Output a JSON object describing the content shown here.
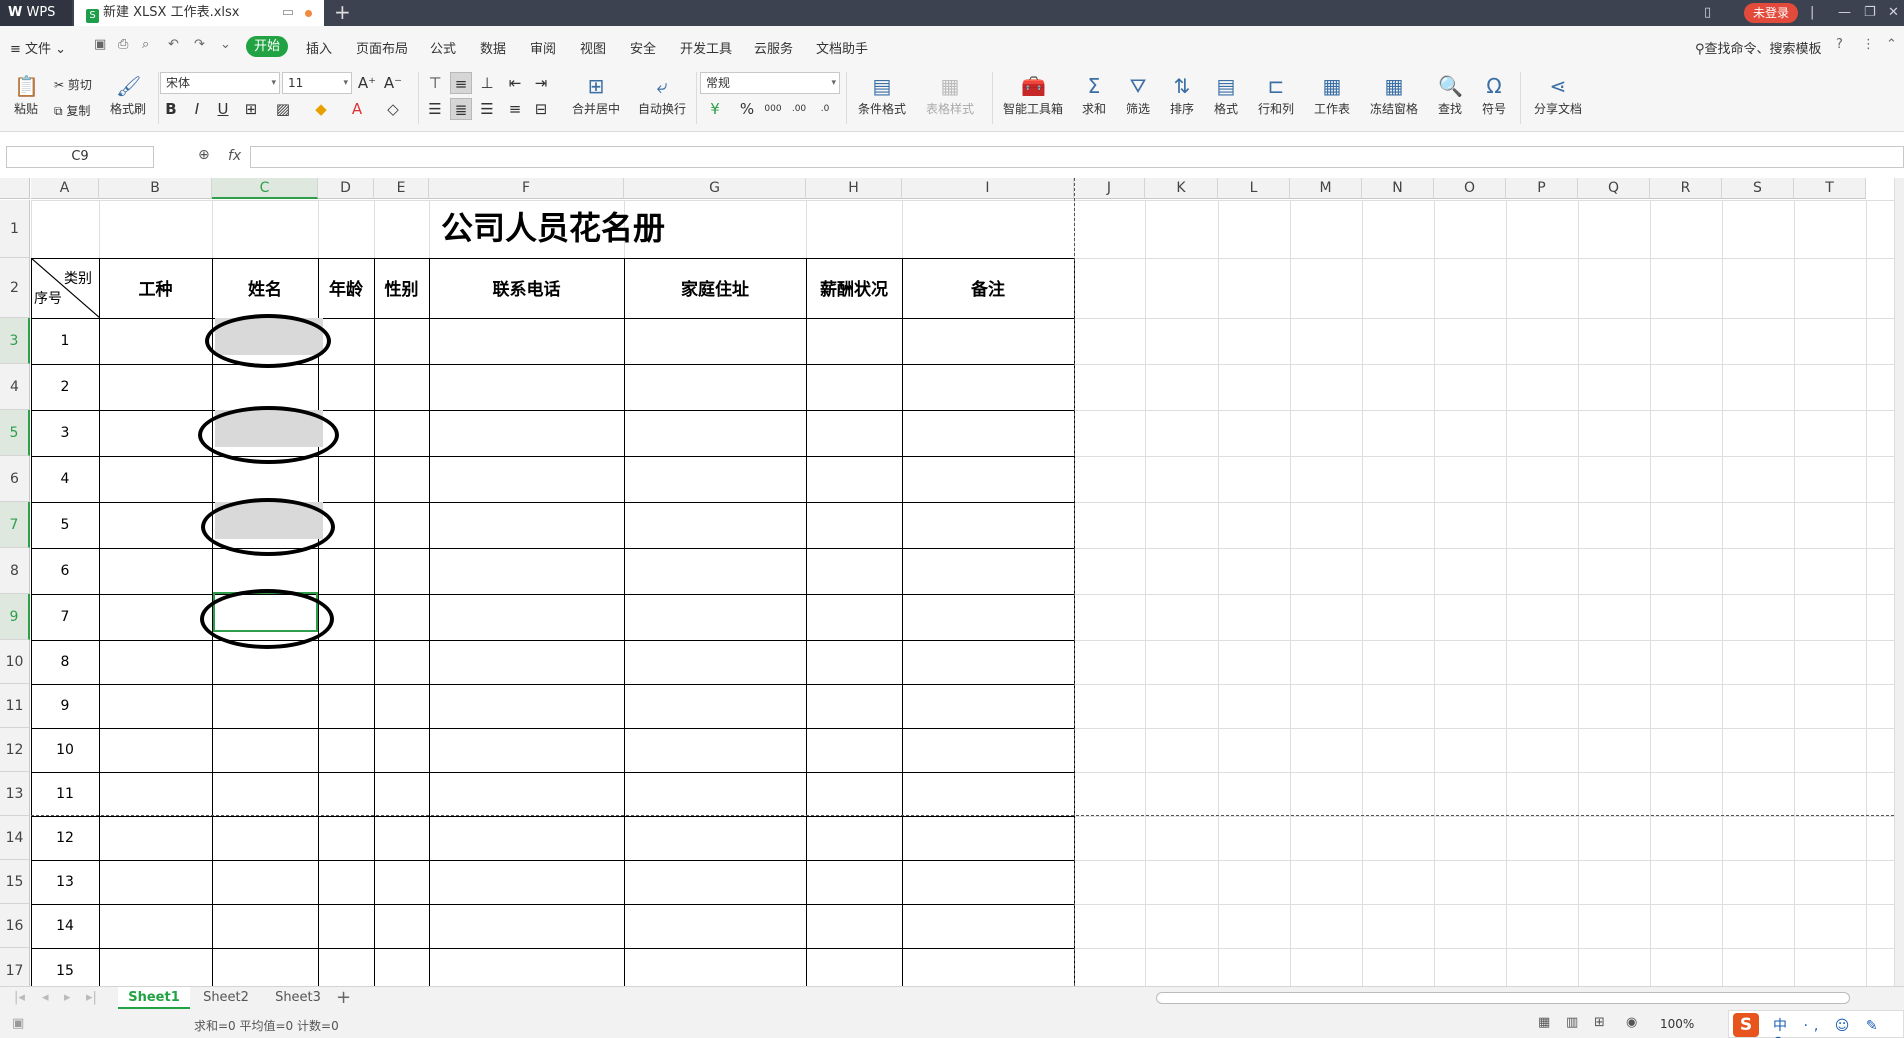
{
  "titlebar": {
    "app_label": "WPS",
    "doc_tab_title": "新建 XLSX 工作表.xlsx",
    "login_label": "未登录"
  },
  "menubar": {
    "file_label": "文件",
    "tabs": [
      "开始",
      "插入",
      "页面布局",
      "公式",
      "数据",
      "审阅",
      "视图",
      "安全",
      "开发工具",
      "云服务",
      "文档助手"
    ],
    "search_label": "查找命令、搜索模板"
  },
  "ribbon": {
    "paste_label": "粘贴",
    "cut_label": "剪切",
    "copy_label": "复制",
    "format_painter_label": "格式刷",
    "font_name": "宋体",
    "font_size": "11",
    "merge_label": "合并居中",
    "wrap_label": "自动换行",
    "number_format": "常规",
    "cond_format_label": "条件格式",
    "table_style_label": "表格样式",
    "smart_toolbox_label": "智能工具箱",
    "sum_label": "求和",
    "filter_label": "筛选",
    "sort_label": "排序",
    "format_label": "格式",
    "rowcol_label": "行和列",
    "worksheet_label": "工作表",
    "freeze_label": "冻结窗格",
    "find_label": "查找",
    "symbol_label": "符号",
    "share_label": "分享文档"
  },
  "formulabar": {
    "cell_ref": "C9",
    "fx_label": "fx",
    "formula": ""
  },
  "sheet": {
    "columns": [
      "A",
      "B",
      "C",
      "D",
      "E",
      "F",
      "G",
      "H",
      "I",
      "J",
      "K",
      "L",
      "M",
      "N",
      "O",
      "P",
      "Q",
      "R",
      "S",
      "T"
    ],
    "rows": [
      "1",
      "2",
      "3",
      "4",
      "5",
      "6",
      "7",
      "8",
      "9",
      "10",
      "11",
      "12",
      "13",
      "14",
      "15",
      "16",
      "17"
    ],
    "title": "公司人员花名册",
    "diag_top": "类别",
    "diag_bottom": "序号",
    "headers": [
      "工种",
      "姓名",
      "年龄",
      "性别",
      "联系电话",
      "家庭住址",
      "薪酬状况",
      "备注"
    ],
    "seq": [
      "1",
      "2",
      "3",
      "4",
      "5",
      "6",
      "7",
      "8",
      "9",
      "10",
      "11",
      "12",
      "13",
      "14",
      "15"
    ]
  },
  "sheet_tabs": [
    "Sheet1",
    "Sheet2",
    "Sheet3"
  ],
  "status": {
    "summary": "求和=0  平均值=0  计数=0",
    "zoom": "100%"
  },
  "ime": {
    "brand": "S",
    "text": "中 ·, ☺ ✎ ⚲"
  },
  "colors": {
    "accent": "#21a344",
    "titlebar": "#3c4250",
    "login": "#e24a3b"
  }
}
